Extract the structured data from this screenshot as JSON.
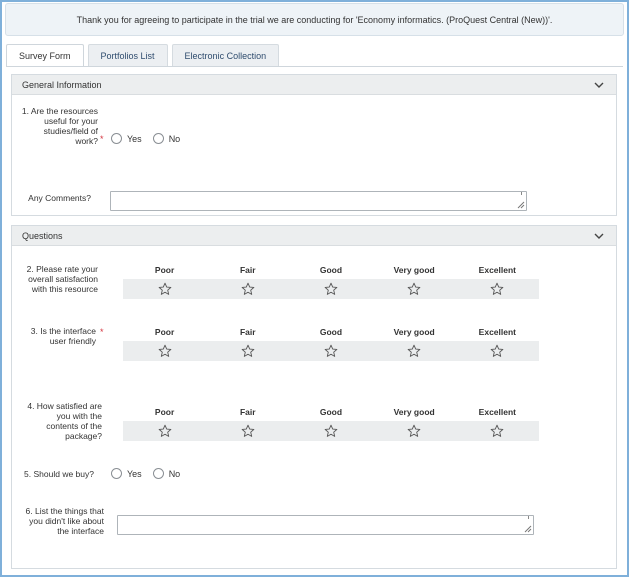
{
  "banner": {
    "text": "Thank you for agreeing to participate in the trial we are conducting for 'Economy informatics. (ProQuest Central (New))'."
  },
  "tabs": [
    {
      "label": "Survey Form",
      "active": true
    },
    {
      "label": "Portfolios List",
      "active": false
    },
    {
      "label": "Electronic Collection",
      "active": false
    }
  ],
  "general": {
    "title": "General Information",
    "q1": {
      "label_lines": [
        "1. Are the resources",
        "useful for your",
        "studies/field of",
        "work?"
      ],
      "required": "*",
      "yes": "Yes",
      "no": "No"
    },
    "comments_label": "Any Comments?"
  },
  "questions": {
    "title": "Questions",
    "scale": [
      "Poor",
      "Fair",
      "Good",
      "Very good",
      "Excellent"
    ],
    "q2": {
      "label_lines": [
        "2. Please rate your",
        "overall satisfaction",
        "with this resource"
      ]
    },
    "q3": {
      "label_lines": [
        "3. Is the interface",
        "user friendly"
      ],
      "required": "*"
    },
    "q4": {
      "label_lines": [
        "4. How satisfied are",
        "you with the",
        "contents of the",
        "package?"
      ]
    },
    "q5": {
      "label": "5. Should we buy?",
      "yes": "Yes",
      "no": "No"
    },
    "q6": {
      "label_lines": [
        "6. List the things that",
        "you didn't like about",
        "the interface"
      ]
    }
  },
  "icons": {
    "chevron": "chevron-down-icon",
    "star": "star-outline-icon",
    "resize": "resize-grip-icon"
  }
}
